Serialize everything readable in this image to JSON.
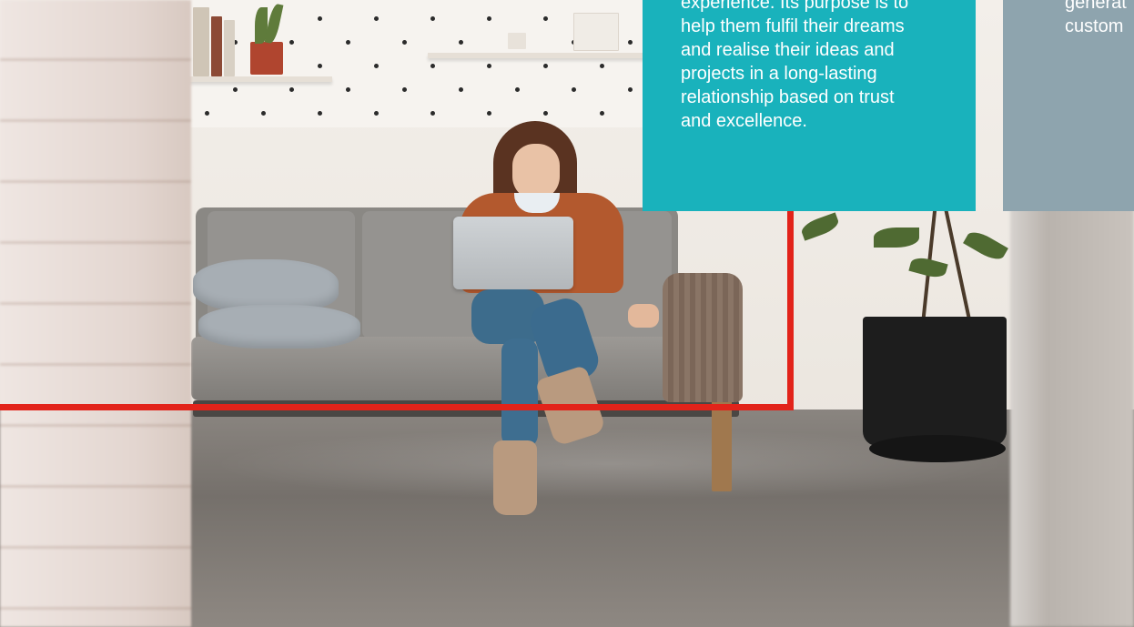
{
  "colors": {
    "teal_card": "#19b2bc",
    "gray_card": "#8ea4ae",
    "accent_red": "#e2231a"
  },
  "teal_card": {
    "lines": [
      "experience. Its purpose is to",
      "help them fulfil their dreams",
      "and realise their ideas and",
      "projects in a long-lasting",
      "relationship based on trust",
      "and excellence."
    ]
  },
  "gray_card": {
    "lines": [
      "generat",
      "custom"
    ]
  },
  "photo": {
    "subject": "woman-on-sofa-with-laptop"
  }
}
